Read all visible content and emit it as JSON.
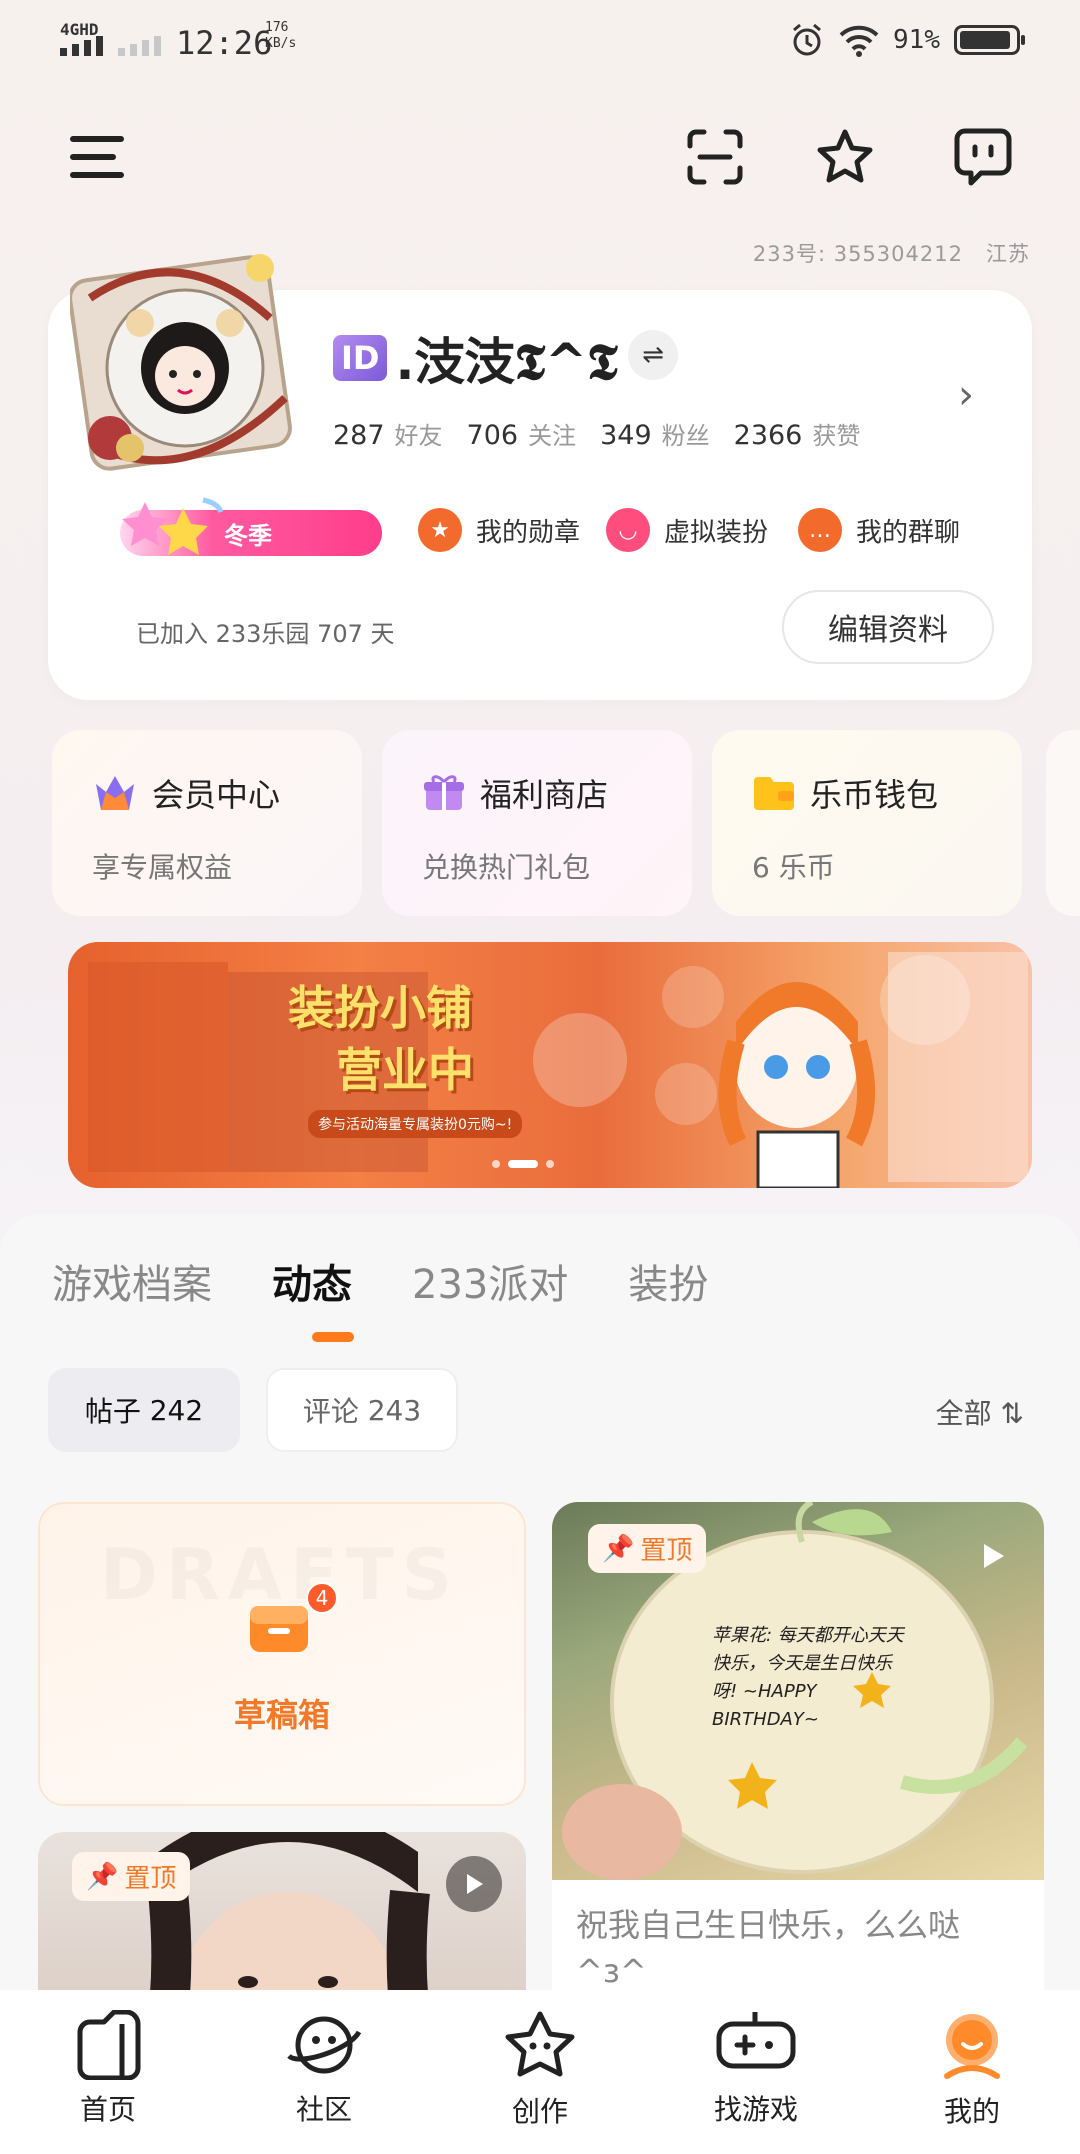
{
  "status_bar": {
    "network": "4GHD",
    "time": "12:26",
    "speed_value": "176",
    "speed_unit": "KB/s",
    "battery": "91%"
  },
  "header": {
    "uid_line": "233号: 355304212",
    "location": "江苏"
  },
  "profile": {
    "name": ".汥汥𝕿^𝕿",
    "id_badge": "ID",
    "stats": [
      {
        "value": "287",
        "label": "好友"
      },
      {
        "value": "706",
        "label": "关注"
      },
      {
        "value": "349",
        "label": "粉丝"
      },
      {
        "value": "2366",
        "label": "获赞"
      }
    ],
    "season_label": "冬季",
    "quick_links": [
      {
        "label": "我的勋章",
        "color": "#f36b2c"
      },
      {
        "label": "虚拟装扮",
        "color": "#ff4d7d"
      },
      {
        "label": "我的群聊",
        "color": "#f36b2c"
      }
    ],
    "joined_text": "已加入 233乐园 707 天",
    "edit_button": "编辑资料"
  },
  "features": [
    {
      "title": "会员中心",
      "subtitle": "享专属权益"
    },
    {
      "title": "福利商店",
      "subtitle": "兑换热门礼包"
    },
    {
      "title": "乐币钱包",
      "subtitle": "6 乐币"
    }
  ],
  "banner": {
    "title_line1": "装扮小铺",
    "title_line2": "营业中",
    "caption": "参与活动海量专属装扮0元购~!"
  },
  "content": {
    "tabs": [
      "游戏档案",
      "动态",
      "233派对",
      "装扮"
    ],
    "chips": [
      {
        "label": "帖子",
        "count": "242"
      },
      {
        "label": "评论",
        "count": "243"
      }
    ],
    "filter": "全部",
    "draft": {
      "bg_text": "DRAFTS",
      "label": "草稿箱",
      "badge": "4"
    },
    "pin_label": "置顶",
    "post1_text": "祝我自己生日快乐，么么哒 ^з^",
    "post1_note": "苹果花: 每天都开心天天 快乐，今天是生日快乐呀! ~HAPPY BIRTHDAY~"
  },
  "nav": [
    {
      "label": "首页"
    },
    {
      "label": "社区"
    },
    {
      "label": "创作"
    },
    {
      "label": "找游戏"
    },
    {
      "label": "我的"
    }
  ]
}
